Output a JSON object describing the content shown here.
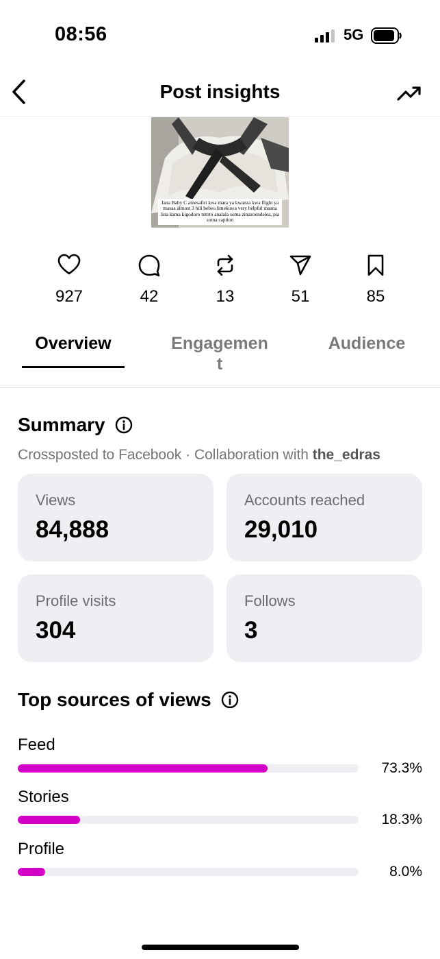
{
  "status_bar": {
    "time": "08:56",
    "network": "5G",
    "signal_icon": "signal-bars-icon",
    "battery_icon": "battery-icon"
  },
  "header": {
    "title": "Post insights",
    "back_icon": "chevron-left-icon",
    "trend_icon": "trending-up-icon"
  },
  "post": {
    "caption": "Jana Baby C amesafiri kwa mara ya kwanza kwa flight ya masaa almost 3 hili bebeo limekuwa very helpful maana lina kama kigodoro mtoto analala soma zinazoendelea, pia soma caption"
  },
  "stats": [
    {
      "icon": "heart-icon",
      "value": "927"
    },
    {
      "icon": "comment-icon",
      "value": "42"
    },
    {
      "icon": "repost-icon",
      "value": "13"
    },
    {
      "icon": "share-icon",
      "value": "51"
    },
    {
      "icon": "bookmark-icon",
      "value": "85"
    }
  ],
  "tabs": [
    {
      "label": "Overview",
      "active": true
    },
    {
      "label": "Engagemen",
      "label_wrap": "t",
      "active": false
    },
    {
      "label": "Audience",
      "active": false
    }
  ],
  "summary": {
    "title": "Summary",
    "subtitle_prefix": "Crossposted to Facebook · Collaboration with ",
    "collaborator": "the_edras",
    "cards": [
      {
        "label": "Views",
        "value": "84,888"
      },
      {
        "label": "Accounts reached",
        "value": "29,010"
      },
      {
        "label": "Profile visits",
        "value": "304"
      },
      {
        "label": "Follows",
        "value": "3"
      }
    ]
  },
  "sources": {
    "title": "Top sources of views",
    "accent_color": "#d300c5",
    "items": [
      {
        "label": "Feed",
        "percent_text": "73.3%",
        "fraction": 0.733
      },
      {
        "label": "Stories",
        "percent_text": "18.3%",
        "fraction": 0.183
      },
      {
        "label": "Profile",
        "percent_text": "8.0%",
        "fraction": 0.08
      }
    ]
  }
}
